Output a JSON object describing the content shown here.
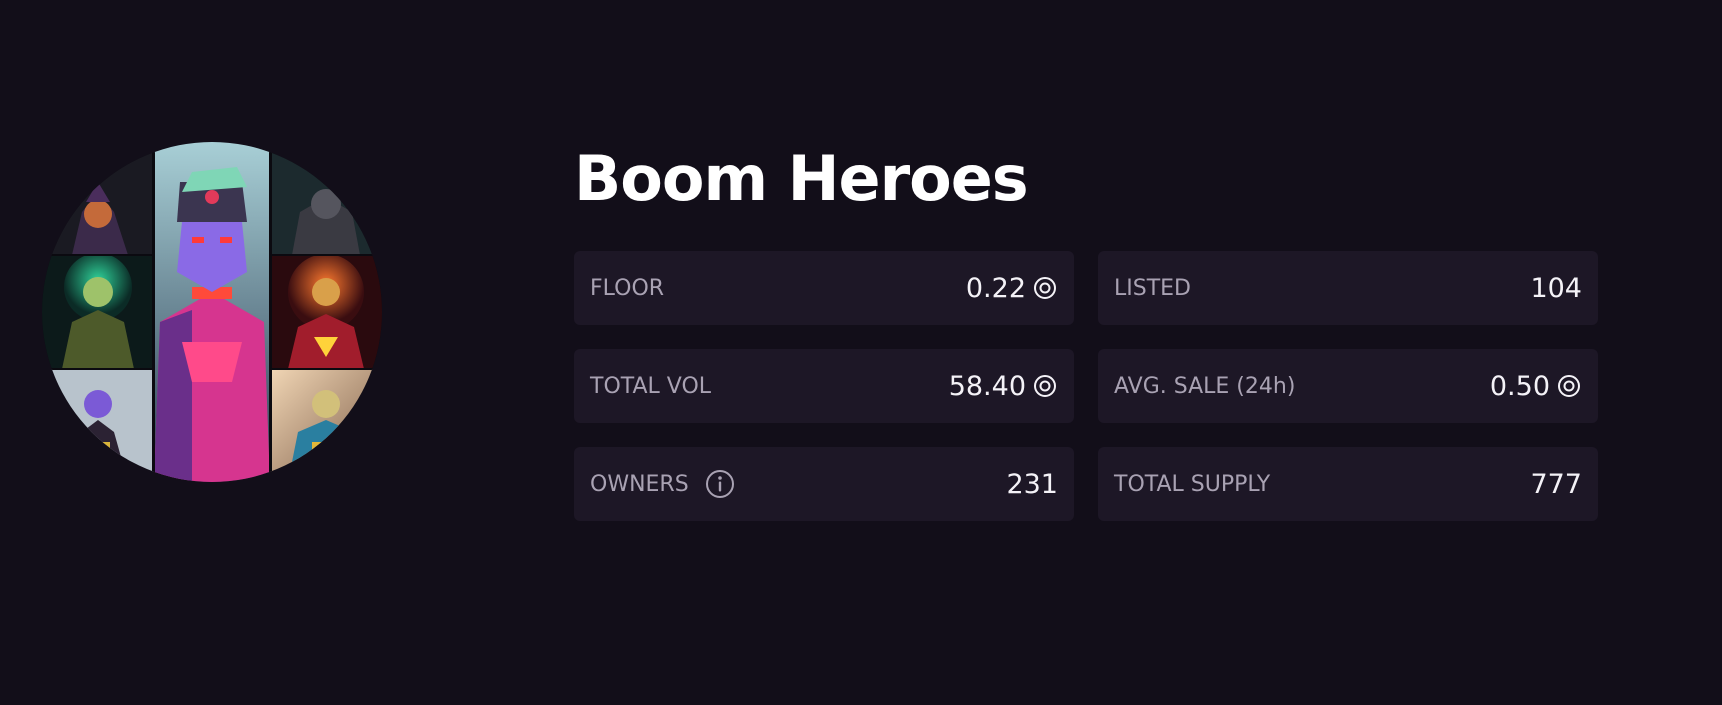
{
  "collection": {
    "name": "Boom Heroes",
    "avatar_icon": "collection-avatar-heroes-collage"
  },
  "stats": [
    {
      "key": "floor",
      "label": "FLOOR",
      "value": "0.22",
      "currency_icon": "sol-icon"
    },
    {
      "key": "listed",
      "label": "LISTED",
      "value": "104"
    },
    {
      "key": "total_vol",
      "label": "TOTAL VOL",
      "value": "58.40",
      "currency_icon": "sol-icon"
    },
    {
      "key": "avg_sale",
      "label": "AVG. SALE (24h)",
      "value": "0.50",
      "currency_icon": "sol-icon"
    },
    {
      "key": "owners",
      "label": "OWNERS",
      "value": "231",
      "info_icon": "info-icon"
    },
    {
      "key": "total_supply",
      "label": "TOTAL SUPPLY",
      "value": "777"
    }
  ],
  "colors": {
    "background": "#120e19",
    "card": "#1d1726",
    "label": "#a9a2b3",
    "value": "#f4f2f7"
  }
}
